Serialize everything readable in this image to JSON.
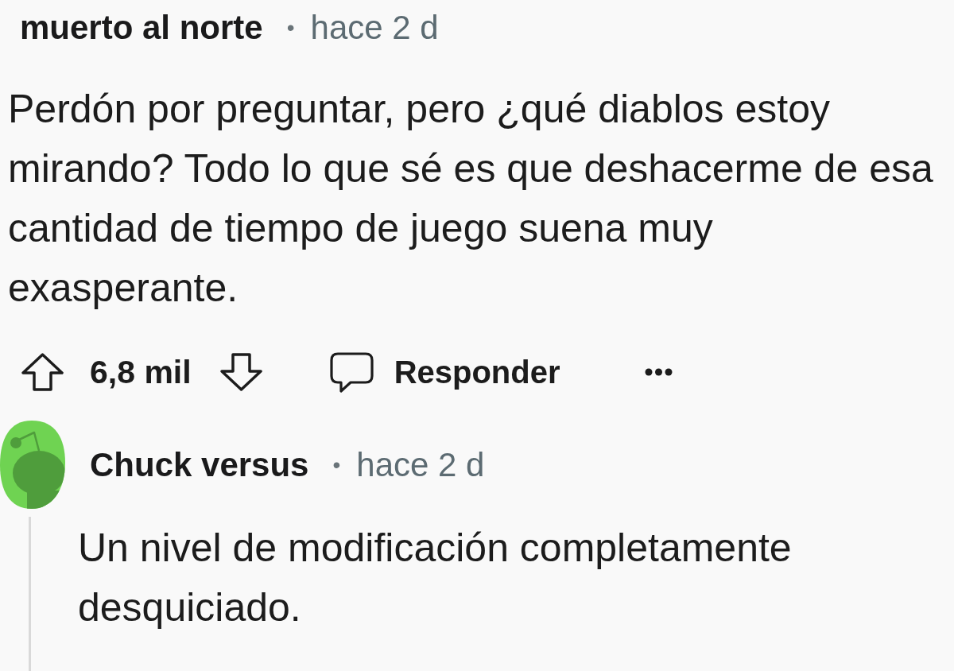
{
  "comment": {
    "author": "muerto al norte",
    "separator": "•",
    "time": "hace 2 d",
    "body": "Perdón por preguntar, pero ¿qué diablos estoy mirando? Todo lo que sé es que deshacerme de esa cantidad de tiempo de juego suena muy exasperante.",
    "actions": {
      "score": "6,8 mil",
      "reply": "Responder"
    }
  },
  "reply": {
    "author": "Chuck versus",
    "separator": "•",
    "time": "hace 2 d",
    "body": "Un nivel de modificación completamente desquiciado."
  }
}
